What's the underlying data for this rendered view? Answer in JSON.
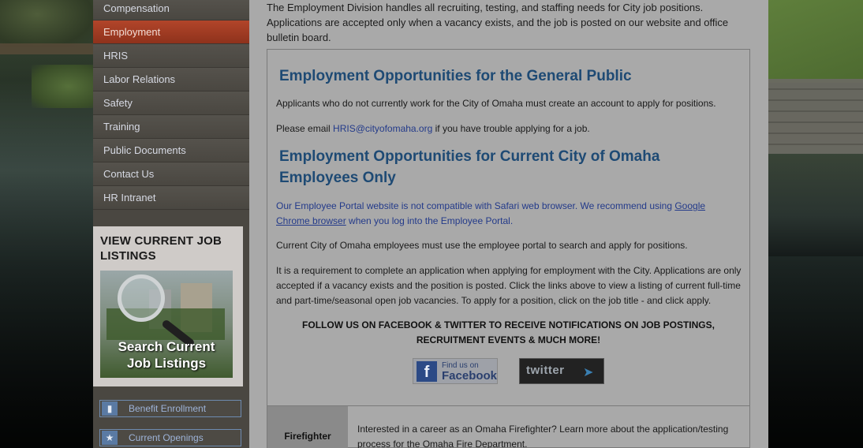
{
  "sidebar": {
    "nav_items": [
      {
        "label": "Compensation",
        "active": false
      },
      {
        "label": "Employment",
        "active": true
      },
      {
        "label": "HRIS",
        "active": false
      },
      {
        "label": "Labor Relations",
        "active": false
      },
      {
        "label": "Safety",
        "active": false
      },
      {
        "label": "Training",
        "active": false
      },
      {
        "label": "Public Documents",
        "active": false
      },
      {
        "label": "Contact Us",
        "active": false
      },
      {
        "label": "HR Intranet",
        "active": false
      }
    ],
    "listings": {
      "title": "VIEW CURRENT JOB LISTINGS",
      "image_line1": "Search Current",
      "image_line2": "Job Listings"
    },
    "quick_links": [
      {
        "label": "Benefit Enrollment",
        "icon": "benefit-icon"
      },
      {
        "label": "Current Openings",
        "icon": "person-icon"
      }
    ]
  },
  "main": {
    "intro": "The Employment Division handles all recruiting, testing, and staffing needs for City job positions. Applications are accepted only when a vacancy exists, and the job is posted on our website and office bulletin board.",
    "general_public": {
      "heading": "Employment Opportunities for the General Public",
      "p1": "Applicants who do not currently work for the City of Omaha must create an account to apply for positions.",
      "p2_before": "Please email ",
      "p2_email": "HRIS@cityofomaha.org",
      "p2_after": " if you have trouble applying for a job."
    },
    "employees": {
      "heading": "Employment Opportunities for Current City of Omaha Employees Only",
      "notice_before": "Our Employee Portal website is not compatible with Safari web browser. We recommend using ",
      "notice_link": "Google Chrome browser",
      "notice_after": " when you log into the Employee Portal.",
      "p1": "Current City of Omaha employees must use the employee portal to search and apply for positions.",
      "p2": "It is a requirement to complete an application when applying for employment with the City. Applications are only accepted if a vacancy exists and the position is posted. Click the links above to view a listing of current full-time and part-time/seasonal open job vacancies. To apply for a position, click on the job title - and click apply."
    },
    "follow": {
      "line1": "FOLLOW US ON FACEBOOK & TWITTER TO RECEIVE NOTIFICATIONS ON JOB POSTINGS,",
      "line2": "RECRUITMENT EVENTS & MUCH MORE!"
    },
    "facebook": {
      "line1": "Find us on",
      "line2": "Facebook",
      "logo": "f"
    },
    "twitter": {
      "label": "twitter"
    },
    "firefighter": {
      "label": "Firefighter",
      "text": "Interested in a career as an Omaha Firefighter?  Learn more about the application/testing process for the Omaha Fire Department."
    }
  }
}
